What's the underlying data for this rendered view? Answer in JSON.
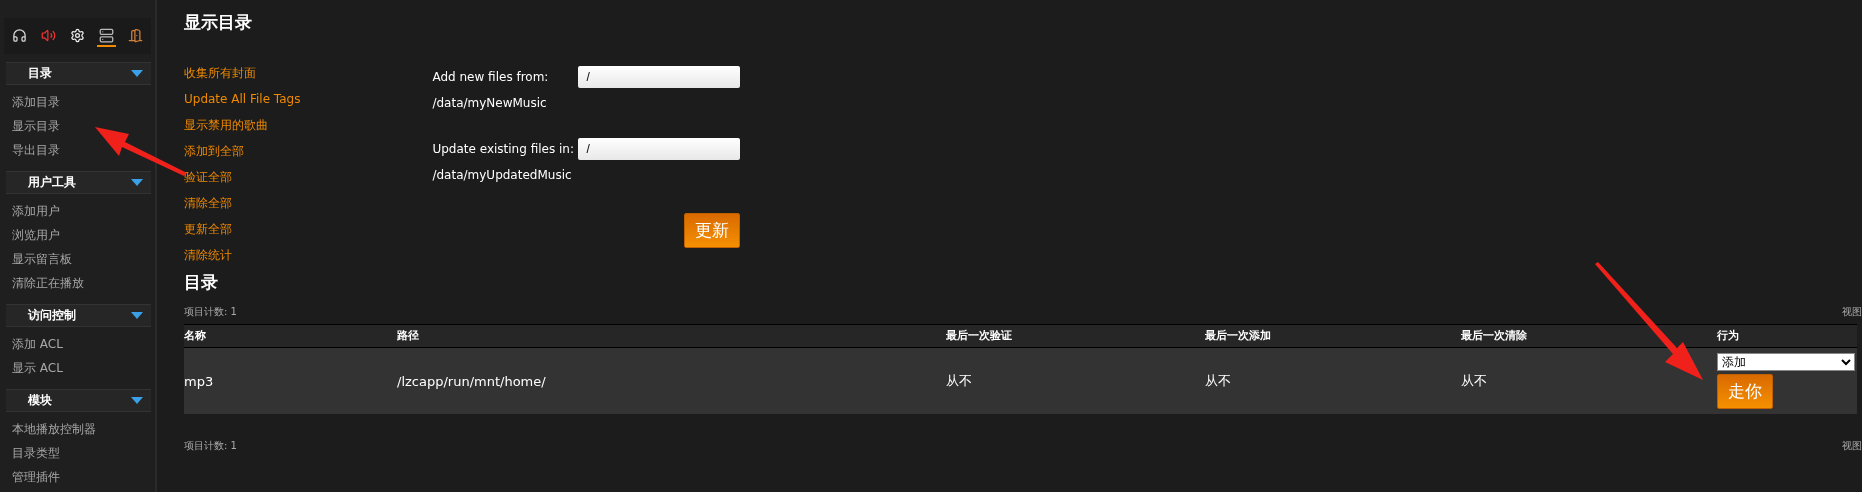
{
  "sidebar": {
    "toolbar": [
      {
        "kind": "headphones",
        "selected": false
      },
      {
        "kind": "speaker",
        "selected": false
      },
      {
        "kind": "gear",
        "selected": false
      },
      {
        "kind": "server",
        "selected": true
      },
      {
        "kind": "door",
        "selected": false
      }
    ],
    "sections": [
      {
        "title": "目录",
        "expanded": true,
        "items": [
          "添加目录",
          "显示目录",
          "导出目录"
        ]
      },
      {
        "title": "用户工具",
        "expanded": true,
        "items": [
          "添加用户",
          "浏览用户",
          "显示留言板",
          "清除正在播放"
        ]
      },
      {
        "title": "访问控制",
        "expanded": true,
        "items": [
          "添加 ACL",
          "显示 ACL"
        ]
      },
      {
        "title": "模块",
        "expanded": true,
        "items": [
          "本地播放控制器",
          "目录类型",
          "管理插件"
        ]
      }
    ]
  },
  "page_title": "显示目录",
  "actions": [
    "收集所有封面",
    "Update All File Tags",
    "显示禁用的歌曲",
    "添加到全部",
    "验证全部",
    "清除全部",
    "更新全部",
    "清除统计"
  ],
  "update_form": {
    "fields": [
      {
        "label": "Add new files from: /data/myNewMusic",
        "value": "/"
      },
      {
        "label": "Update existing files in: /data/myUpdatedMusic",
        "value": "/"
      }
    ],
    "button": "更新"
  },
  "catalog": {
    "title": "目录",
    "item_count_top": "项目计数: 1",
    "view_top": "视图",
    "item_count_bottom": "项目计数: 1",
    "view_bottom": "视图",
    "columns": [
      "名称",
      "路径",
      "最后一次验证",
      "最后一次添加",
      "最后一次清除",
      "行为"
    ],
    "rows": [
      {
        "cells": [
          "mp3",
          "/lzcapp/run/mnt/home/",
          "从不",
          "从不",
          "从不"
        ],
        "action": "添加",
        "button": "走你"
      }
    ]
  }
}
